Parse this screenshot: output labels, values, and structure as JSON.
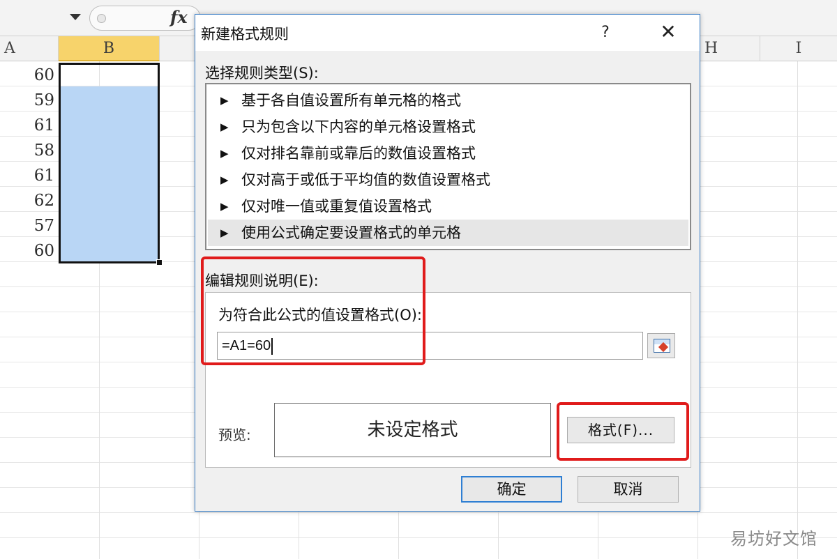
{
  "spreadsheet": {
    "fx_label": "fx",
    "columns": [
      {
        "label": "A",
        "active": false
      },
      {
        "label": "B",
        "active": true
      },
      {
        "label": "H",
        "active": false
      },
      {
        "label": "I",
        "active": false
      }
    ],
    "column_b_values": [
      "60",
      "59",
      "61",
      "58",
      "61",
      "62",
      "57",
      "60"
    ],
    "selection_color": "#b9d6f5",
    "active_header_color": "#f7d36b"
  },
  "dialog": {
    "title": "新建格式规则",
    "help_label": "?",
    "close_label": "✕",
    "rule_type_label": "选择规则类型(S):",
    "rule_types": [
      "基于各自值设置所有单元格的格式",
      "只为包含以下内容的单元格设置格式",
      "仅对排名靠前或靠后的数值设置格式",
      "仅对高于或低于平均值的数值设置格式",
      "仅对唯一值或重复值设置格式",
      "使用公式确定要设置格式的单元格"
    ],
    "selected_rule_index": 5,
    "edit_desc_label": "编辑规则说明(E):",
    "formula_label": "为符合此公式的值设置格式(O):",
    "formula_value": "=A1=60",
    "preview_label": "预览:",
    "preview_text": "未设定格式",
    "format_button": "格式(F)...",
    "ok_button": "确定",
    "cancel_button": "取消"
  },
  "annotation_color": "#e01b1b",
  "watermark": "易坊好文馆"
}
